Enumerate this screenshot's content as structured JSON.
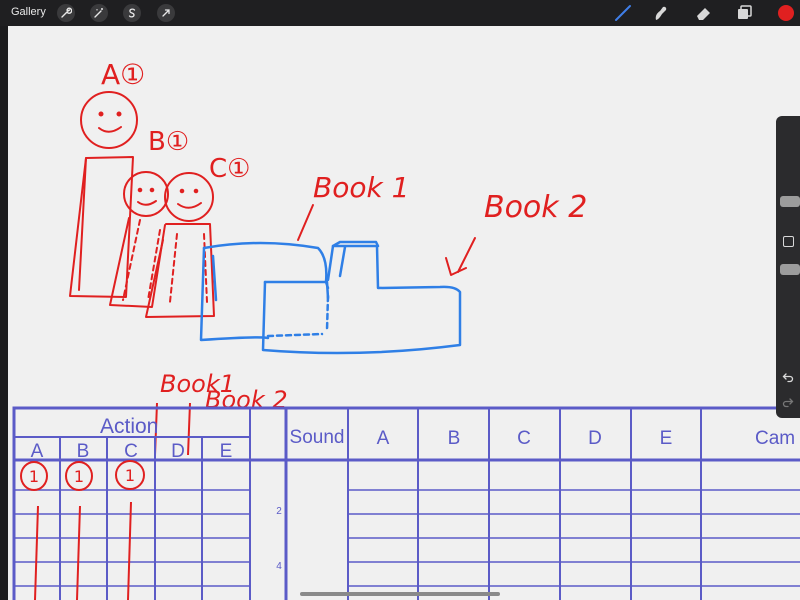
{
  "toolbar": {
    "gallery_label": "Gallery",
    "left_icons": [
      "wrench-icon",
      "magic-wand-icon",
      "selection-s-icon",
      "transform-arrow-icon"
    ],
    "right_icons": [
      "brush-icon",
      "smudge-icon",
      "eraser-icon",
      "layers-icon",
      "color-swatch-icon"
    ],
    "color_swatch": "#e02020",
    "brush_accent": "#3f7ee8"
  },
  "sidebar": {
    "icons": [
      "size-slider-icon",
      "modify-square-icon",
      "opacity-slider-icon",
      "undo-icon",
      "redo-icon"
    ]
  },
  "sketch": {
    "labels": {
      "a": "A①",
      "b": "B①",
      "c": "C①",
      "book1": "Book 1",
      "book2": "Book 2",
      "sheet_book1": "Book1",
      "sheet_book2": "Book 2"
    },
    "colors": {
      "red": "#e02020",
      "blue": "#2f7fe6",
      "sheet": "#5b5bc7"
    }
  },
  "sheet": {
    "action_header": "Action",
    "action_cols": [
      "A",
      "B",
      "C",
      "D",
      "E"
    ],
    "sound_header": "Sound",
    "cols": [
      "A",
      "B",
      "C",
      "D",
      "E"
    ],
    "camera_header": "Cam",
    "row_numbers": [
      "2",
      "4"
    ],
    "marks": [
      "1",
      "1",
      "1"
    ]
  }
}
